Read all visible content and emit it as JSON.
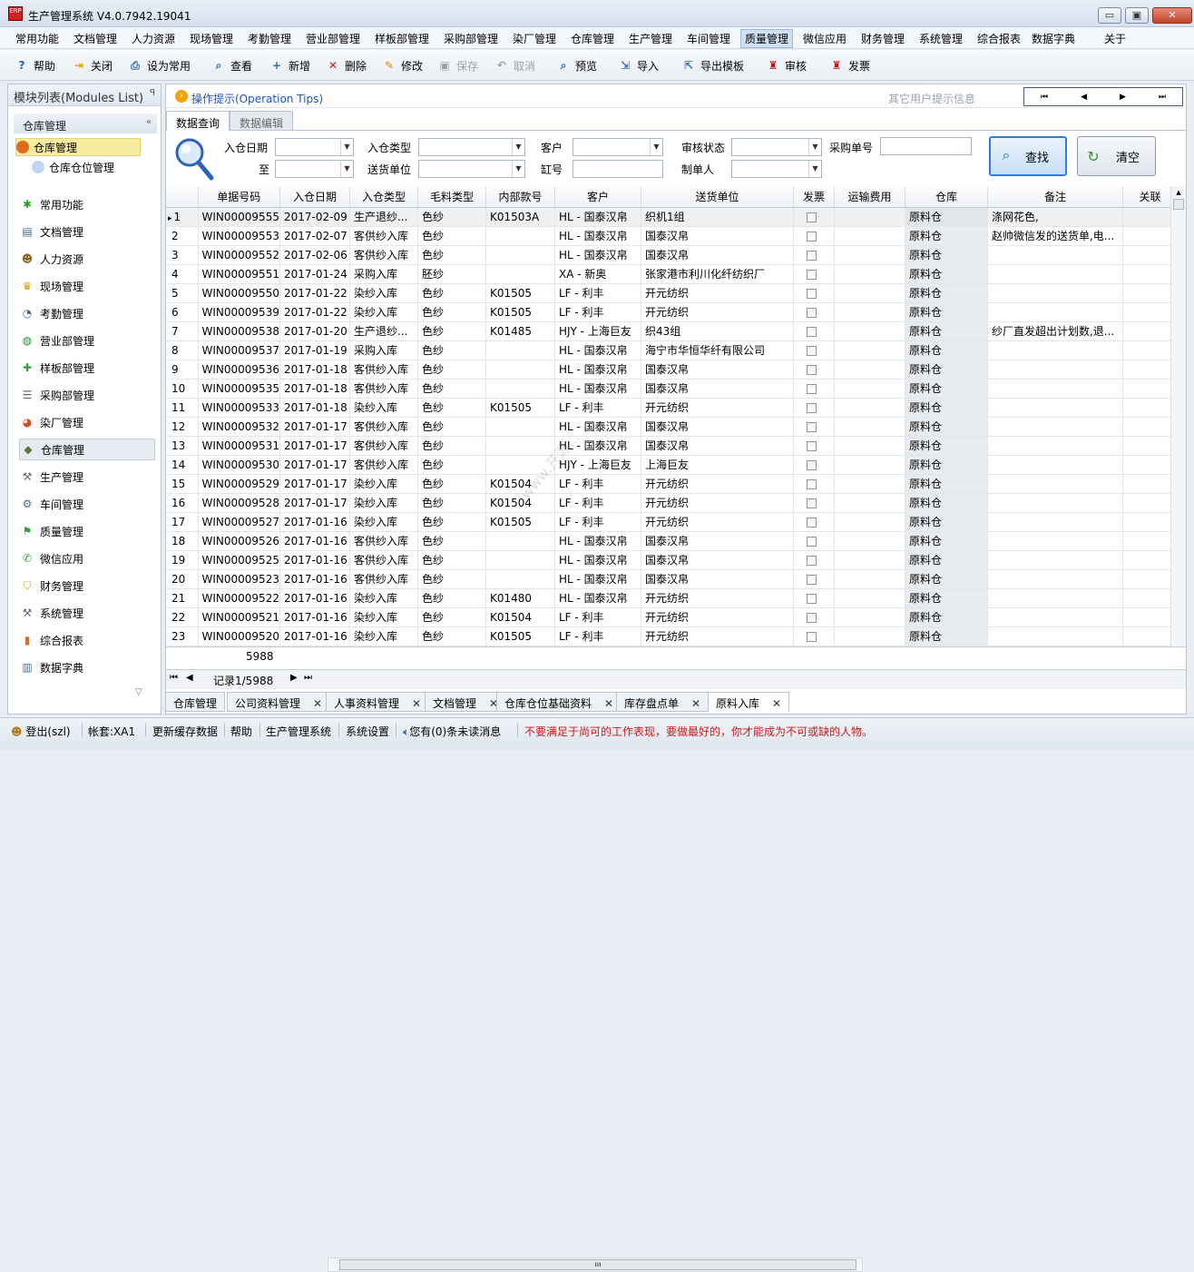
{
  "window": {
    "title": "生产管理系统 V4.0.7942.19041",
    "logo": "ERP",
    "min": "▭",
    "max": "▣",
    "close": "✕"
  },
  "menu": [
    "常用功能",
    "文档管理",
    "人力资源",
    "现场管理",
    "考勤管理",
    "营业部管理",
    "样板部管理",
    "采购部管理",
    "染厂管理",
    "仓库管理",
    "生产管理",
    "车间管理",
    "质量管理",
    "微信应用",
    "财务管理",
    "系统管理",
    "综合报表",
    "数据字典",
    "关于"
  ],
  "menu_active": "质量管理",
  "toolbar": [
    {
      "label": "帮助",
      "icon": "help-icon",
      "glyph": "?",
      "color": "#1f63c8",
      "enabled": true
    },
    {
      "label": "关闭",
      "icon": "exit-icon",
      "glyph": "⇥",
      "color": "#d9a400",
      "enabled": true
    },
    {
      "label": "设为常用",
      "icon": "printer-icon",
      "glyph": "⎙",
      "color": "#2a6db8",
      "enabled": true
    },
    {
      "label": "查看",
      "icon": "view-icon",
      "glyph": "⌕",
      "color": "#2a6db8",
      "enabled": true
    },
    {
      "label": "新增",
      "icon": "new-doc-icon",
      "glyph": "+",
      "color": "#2a6db8",
      "enabled": true
    },
    {
      "label": "删除",
      "icon": "delete-icon",
      "glyph": "✕",
      "color": "#d01818",
      "enabled": true
    },
    {
      "label": "修改",
      "icon": "pencil-icon",
      "glyph": "✎",
      "color": "#d98b00",
      "enabled": true
    },
    {
      "label": "保存",
      "icon": "save-icon",
      "glyph": "▣",
      "color": "#9aa2ad",
      "enabled": false
    },
    {
      "label": "取消",
      "icon": "cancel-icon",
      "glyph": "↶",
      "color": "#9aa2ad",
      "enabled": false
    },
    {
      "label": "预览",
      "icon": "preview-icon",
      "glyph": "⌕",
      "color": "#2a6db8",
      "enabled": true
    },
    {
      "label": "导入",
      "icon": "import-icon",
      "glyph": "⇲",
      "color": "#2a6db8",
      "enabled": true
    },
    {
      "label": "导出模板",
      "icon": "export-icon",
      "glyph": "⇱",
      "color": "#2a6db8",
      "enabled": true
    },
    {
      "label": "审核",
      "icon": "stamp-icon",
      "glyph": "♜",
      "color": "#c81414",
      "enabled": true
    },
    {
      "label": "发票",
      "icon": "stamp-icon",
      "glyph": "♜",
      "color": "#c81414",
      "enabled": true
    }
  ],
  "sidebar": {
    "header": "模块列表(Modules List)",
    "pin": "ꟼ",
    "group": "仓库管理",
    "collapse": "«",
    "tree": [
      {
        "label": "仓库管理",
        "selected": true
      },
      {
        "label": "仓库仓位管理",
        "selected": false
      }
    ],
    "modules": [
      {
        "label": "常用功能",
        "icon": "favorites-icon",
        "glyph": "✱",
        "color": "#3b9a2e"
      },
      {
        "label": "文档管理",
        "icon": "document-icon",
        "glyph": "▤",
        "color": "#4a6a8a"
      },
      {
        "label": "人力资源",
        "icon": "people-icon",
        "glyph": "☻",
        "color": "#8a6a2a"
      },
      {
        "label": "现场管理",
        "icon": "crown-icon",
        "glyph": "♛",
        "color": "#d9a400"
      },
      {
        "label": "考勤管理",
        "icon": "clock-icon",
        "glyph": "◔",
        "color": "#4a6a8a"
      },
      {
        "label": "营业部管理",
        "icon": "globe-icon",
        "glyph": "◍",
        "color": "#2a8a3a"
      },
      {
        "label": "样板部管理",
        "icon": "puzzle-icon",
        "glyph": "✚",
        "color": "#3a9a3a"
      },
      {
        "label": "采购部管理",
        "icon": "list-icon",
        "glyph": "☰",
        "color": "#5a6a7a"
      },
      {
        "label": "染厂管理",
        "icon": "pie-chart-icon",
        "glyph": "◕",
        "color": "#d05020"
      },
      {
        "label": "仓库管理",
        "icon": "cube-icon",
        "glyph": "◆",
        "color": "#5a7a3a",
        "selected": true
      },
      {
        "label": "生产管理",
        "icon": "wrench-icon",
        "glyph": "⚒",
        "color": "#6a6a6a"
      },
      {
        "label": "车间管理",
        "icon": "workshop-icon",
        "glyph": "⚙",
        "color": "#4a6a9a"
      },
      {
        "label": "质量管理",
        "icon": "flag-icon",
        "glyph": "⚑",
        "color": "#3a9a3a"
      },
      {
        "label": "微信应用",
        "icon": "wechat-icon",
        "glyph": "✆",
        "color": "#3a9a3a"
      },
      {
        "label": "财务管理",
        "icon": "shield-icon",
        "glyph": "⛉",
        "color": "#d9a400"
      },
      {
        "label": "系统管理",
        "icon": "tools-icon",
        "glyph": "⚒",
        "color": "#5a6a7a"
      },
      {
        "label": "综合报表",
        "icon": "bar-chart-icon",
        "glyph": "▮",
        "color": "#d07020"
      },
      {
        "label": "数据字典",
        "icon": "book-icon",
        "glyph": "▥",
        "color": "#4a6a9a"
      }
    ],
    "scroll_down": "▽"
  },
  "tips": {
    "label": "操作提示(Operation Tips)",
    "other": "其它用户提示信息",
    "nav": [
      "⏮",
      "◀",
      "▶",
      "⏭"
    ]
  },
  "subtabs": [
    "数据查询",
    "数据编辑"
  ],
  "query": {
    "labels": {
      "date": "入仓日期",
      "to": "至",
      "type": "入仓类型",
      "unit": "送货单位",
      "customer": "客户",
      "vat": "缸号",
      "audit": "审核状态",
      "maker": "制单人",
      "po": "采购单号"
    },
    "find": "查找",
    "clear": "清空"
  },
  "grid": {
    "columns": [
      "单据号码",
      "入仓日期",
      "入仓类型",
      "毛料类型",
      "内部款号",
      "客户",
      "送货单位",
      "发票",
      "运输费用",
      "仓库",
      "备注",
      "关联"
    ],
    "rows": [
      [
        "1",
        "WIN00009555",
        "2017-02-09",
        "生产退纱...",
        "色纱",
        "K01503A",
        "HL - 国泰汉帛",
        "织机1组",
        "",
        "原料仓",
        "涤网花色,"
      ],
      [
        "2",
        "WIN00009553",
        "2017-02-07",
        "客供纱入库",
        "色纱",
        "",
        "HL - 国泰汉帛",
        "国泰汉帛",
        "",
        "原料仓",
        "赵帅微信发的送货单,电..."
      ],
      [
        "3",
        "WIN00009552",
        "2017-02-06",
        "客供纱入库",
        "色纱",
        "",
        "HL - 国泰汉帛",
        "国泰汉帛",
        "",
        "原料仓",
        ""
      ],
      [
        "4",
        "WIN00009551",
        "2017-01-24",
        "采购入库",
        "胚纱",
        "",
        "XA - 新奥",
        "张家港市利川化纤纺织厂",
        "",
        "原料仓",
        ""
      ],
      [
        "5",
        "WIN00009550",
        "2017-01-22",
        "染纱入库",
        "色纱",
        "K01505",
        "LF - 利丰",
        "开元纺织",
        "",
        "原料仓",
        ""
      ],
      [
        "6",
        "WIN00009539",
        "2017-01-22",
        "染纱入库",
        "色纱",
        "K01505",
        "LF - 利丰",
        "开元纺织",
        "",
        "原料仓",
        ""
      ],
      [
        "7",
        "WIN00009538",
        "2017-01-20",
        "生产退纱...",
        "色纱",
        "K01485",
        "HJY - 上海巨友",
        "织43组",
        "",
        "原料仓",
        "纱厂直发超出计划数,退..."
      ],
      [
        "8",
        "WIN00009537",
        "2017-01-19",
        "采购入库",
        "色纱",
        "",
        "HL - 国泰汉帛",
        "海宁市华恒华纤有限公司",
        "",
        "原料仓",
        ""
      ],
      [
        "9",
        "WIN00009536",
        "2017-01-18",
        "客供纱入库",
        "色纱",
        "",
        "HL - 国泰汉帛",
        "国泰汉帛",
        "",
        "原料仓",
        ""
      ],
      [
        "10",
        "WIN00009535",
        "2017-01-18",
        "客供纱入库",
        "色纱",
        "",
        "HL - 国泰汉帛",
        "国泰汉帛",
        "",
        "原料仓",
        ""
      ],
      [
        "11",
        "WIN00009533",
        "2017-01-18",
        "染纱入库",
        "色纱",
        "K01505",
        "LF - 利丰",
        "开元纺织",
        "",
        "原料仓",
        ""
      ],
      [
        "12",
        "WIN00009532",
        "2017-01-17",
        "客供纱入库",
        "色纱",
        "",
        "HL - 国泰汉帛",
        "国泰汉帛",
        "",
        "原料仓",
        ""
      ],
      [
        "13",
        "WIN00009531",
        "2017-01-17",
        "客供纱入库",
        "色纱",
        "",
        "HL - 国泰汉帛",
        "国泰汉帛",
        "",
        "原料仓",
        ""
      ],
      [
        "14",
        "WIN00009530",
        "2017-01-17",
        "客供纱入库",
        "色纱",
        "",
        "HJY - 上海巨友",
        "上海巨友",
        "",
        "原料仓",
        ""
      ],
      [
        "15",
        "WIN00009529",
        "2017-01-17",
        "染纱入库",
        "色纱",
        "K01504",
        "LF - 利丰",
        "开元纺织",
        "",
        "原料仓",
        ""
      ],
      [
        "16",
        "WIN00009528",
        "2017-01-17",
        "染纱入库",
        "色纱",
        "K01504",
        "LF - 利丰",
        "开元纺织",
        "",
        "原料仓",
        ""
      ],
      [
        "17",
        "WIN00009527",
        "2017-01-16",
        "染纱入库",
        "色纱",
        "K01505",
        "LF - 利丰",
        "开元纺织",
        "",
        "原料仓",
        ""
      ],
      [
        "18",
        "WIN00009526",
        "2017-01-16",
        "客供纱入库",
        "色纱",
        "",
        "HL - 国泰汉帛",
        "国泰汉帛",
        "",
        "原料仓",
        ""
      ],
      [
        "19",
        "WIN00009525",
        "2017-01-16",
        "客供纱入库",
        "色纱",
        "",
        "HL - 国泰汉帛",
        "国泰汉帛",
        "",
        "原料仓",
        ""
      ],
      [
        "20",
        "WIN00009523",
        "2017-01-16",
        "客供纱入库",
        "色纱",
        "",
        "HL - 国泰汉帛",
        "国泰汉帛",
        "",
        "原料仓",
        ""
      ],
      [
        "21",
        "WIN00009522",
        "2017-01-16",
        "染纱入库",
        "色纱",
        "K01480",
        "HL - 国泰汉帛",
        "开元纺织",
        "",
        "原料仓",
        ""
      ],
      [
        "22",
        "WIN00009521",
        "2017-01-16",
        "染纱入库",
        "色纱",
        "K01504",
        "LF - 利丰",
        "开元纺织",
        "",
        "原料仓",
        ""
      ],
      [
        "23",
        "WIN00009520",
        "2017-01-16",
        "染纱入库",
        "色纱",
        "K01505",
        "LF - 利丰",
        "开元纺织",
        "",
        "原料仓",
        ""
      ]
    ],
    "total": "5988",
    "current_marker": "▸"
  },
  "pager": {
    "first": "⏮",
    "prev": "◀",
    "record": "记录1/5988",
    "next": "▶",
    "last": "⏭",
    "hthumb": "ııı"
  },
  "doc_tabs": [
    {
      "label": "仓库管理",
      "closable": false,
      "active": false
    },
    {
      "label": "公司资料管理",
      "closable": true,
      "active": false
    },
    {
      "label": "人事资料管理",
      "closable": true,
      "active": false
    },
    {
      "label": "文档管理",
      "closable": true,
      "active": false
    },
    {
      "label": "仓库仓位基础资料",
      "closable": true,
      "active": false
    },
    {
      "label": "库存盘点单",
      "closable": true,
      "active": false
    },
    {
      "label": "原料入库",
      "closable": true,
      "active": true
    }
  ],
  "status": {
    "login": "登出(szl)",
    "account": "帐套:XA1",
    "refresh": "更新缓存数据",
    "help": "帮助",
    "system": "生产管理系统",
    "settings": "系统设置",
    "messages": "您有(0)条未读消息",
    "motto": "不要满足于尚可的工作表现，要做最好的，你才能成为不可或缺的人物。"
  },
  "watermark": "www.开源...",
  "colors": {
    "accent": "#1a55c7",
    "motto": "#d01818",
    "selected_bg": "#f7eda0"
  }
}
